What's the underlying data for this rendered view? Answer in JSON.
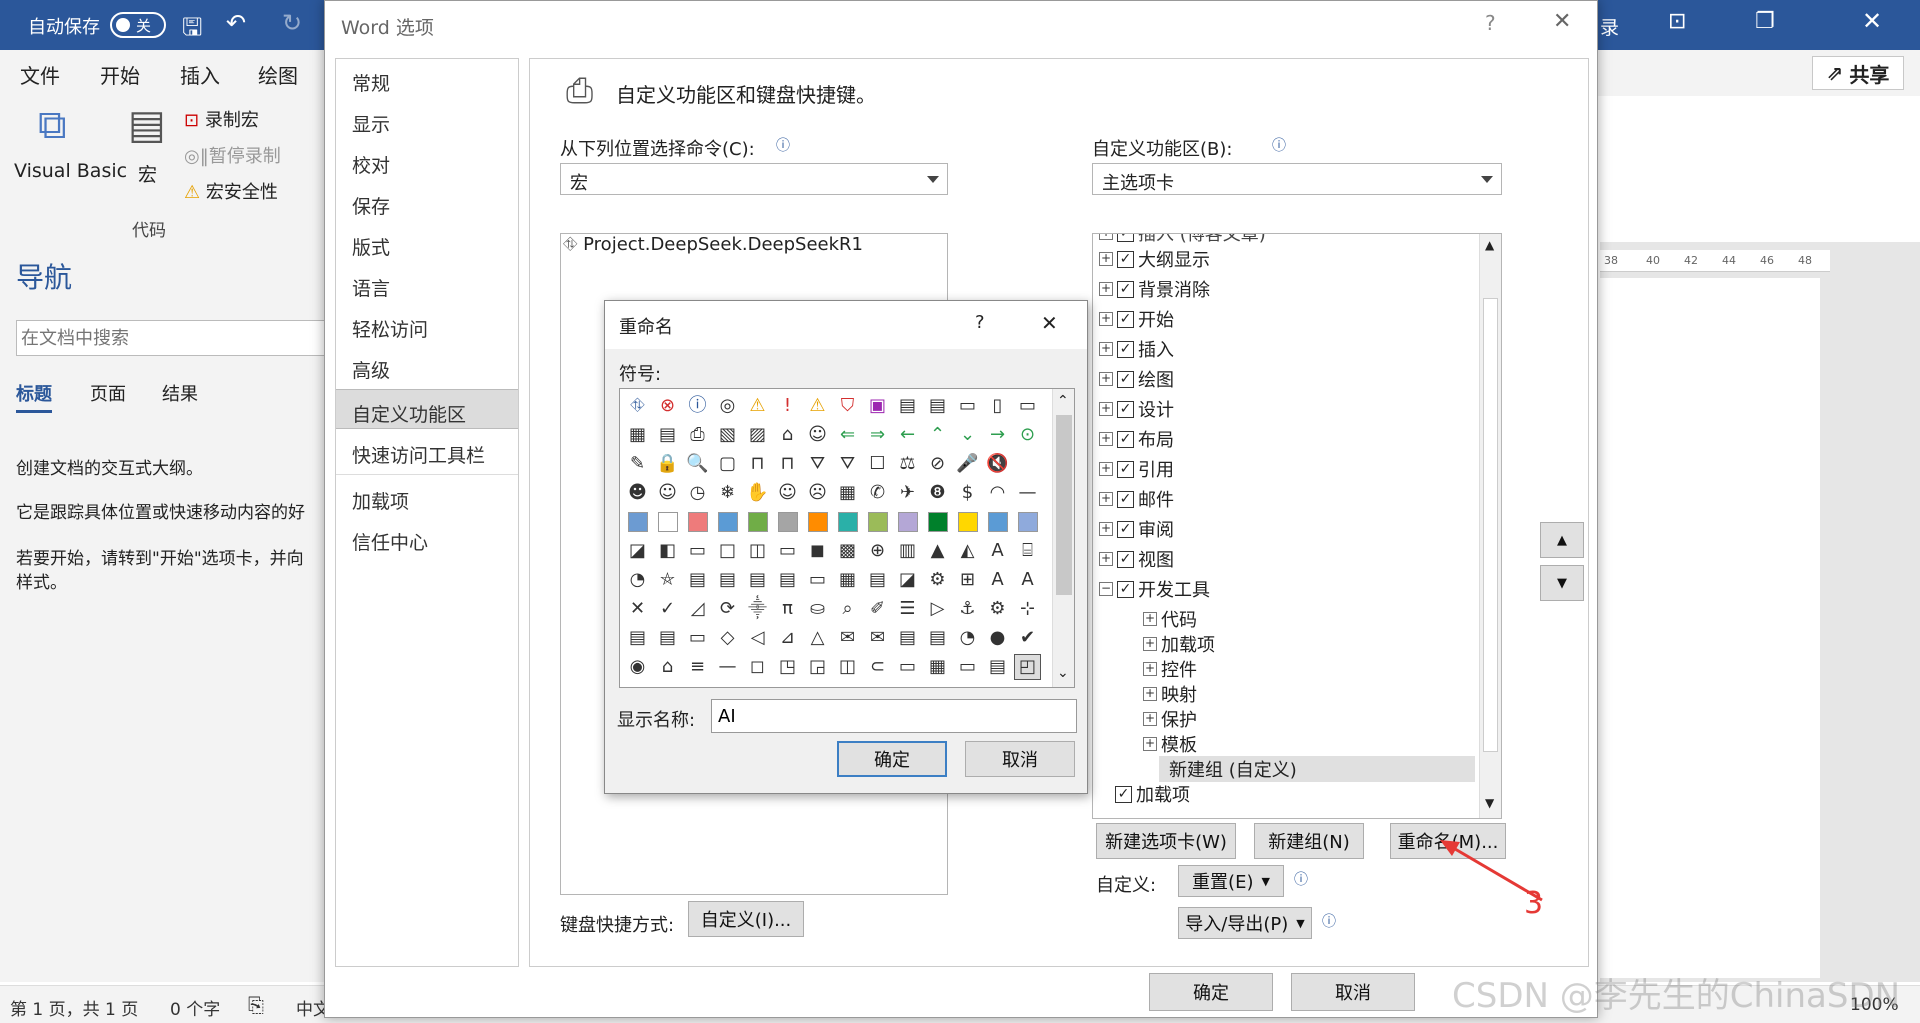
{
  "word": {
    "autosave_label": "自动保存",
    "autosave_state": "关",
    "titlebar_partial": "录",
    "tabs": [
      "文件",
      "开始",
      "插入",
      "绘图"
    ],
    "share_label": "共享",
    "ribbon": {
      "vb_label": "Visual Basic",
      "macro_label": "宏",
      "record_macro": "录制宏",
      "pause_record": "暂停录制",
      "macro_security": "宏安全性",
      "group_label": "代码"
    },
    "nav": {
      "title": "导航",
      "search_placeholder": "在文档中搜索",
      "tabs": [
        "标题",
        "页面",
        "结果"
      ],
      "text1": "创建文档的交互式大纲。",
      "text2": "它是跟踪具体位置或快速移动内容的好",
      "text3": "若要开始，请转到\"开始\"选项卡，并向",
      "text4": "样式。"
    },
    "ruler_marks": [
      "38",
      "40",
      "42",
      "44",
      "46",
      "48"
    ],
    "status": {
      "page": "第 1 页，共 1 页",
      "words": "0 个字",
      "lang": "中文",
      "zoom": "100%"
    }
  },
  "options": {
    "title": "Word 选项",
    "help": "?",
    "close": "✕",
    "left_items": [
      "常规",
      "显示",
      "校对",
      "保存",
      "版式",
      "语言",
      "轻松访问",
      "高级",
      "自定义功能区",
      "快速访问工具栏",
      "加载项",
      "信任中心"
    ],
    "header": "自定义功能区和键盘快捷键。",
    "from_label": "从下列位置选择命令(C):",
    "from_value": "宏",
    "customize_label": "自定义功能区(B):",
    "customize_value": "主选项卡",
    "command_item": "Project.DeepSeek.DeepSeekR1",
    "tree_top_partial": "插入 (博客文章)",
    "tree": [
      {
        "label": "大纲显示",
        "level": 0
      },
      {
        "label": "背景消除",
        "level": 0
      },
      {
        "label": "开始",
        "level": 0
      },
      {
        "label": "插入",
        "level": 0
      },
      {
        "label": "绘图",
        "level": 0
      },
      {
        "label": "设计",
        "level": 0
      },
      {
        "label": "布局",
        "level": 0
      },
      {
        "label": "引用",
        "level": 0
      },
      {
        "label": "邮件",
        "level": 0
      },
      {
        "label": "审阅",
        "level": 0
      },
      {
        "label": "视图",
        "level": 0
      },
      {
        "label": "开发工具",
        "level": 0
      },
      {
        "label": "代码",
        "level": 1
      },
      {
        "label": "加载项",
        "level": 1
      },
      {
        "label": "控件",
        "level": 1
      },
      {
        "label": "映射",
        "level": 1
      },
      {
        "label": "保护",
        "level": 1
      },
      {
        "label": "模板",
        "level": 1
      },
      {
        "label": "新建组 (自定义)",
        "level": 2
      },
      {
        "label": "加载项",
        "level": 3
      }
    ],
    "new_tab_btn": "新建选项卡(W)",
    "new_group_btn": "新建组(N)",
    "rename_btn": "重命名(M)...",
    "customizations_label": "自定义:",
    "reset_btn": "重置(E)",
    "import_export_btn": "导入/导出(P)",
    "keyboard_label": "键盘快捷方式:",
    "keyboard_btn": "自定义(I)...",
    "ok_btn": "确定",
    "cancel_btn": "取消"
  },
  "rename": {
    "title": "重命名",
    "help": "?",
    "close": "✕",
    "symbol_label": "符号:",
    "display_name_label": "显示名称:",
    "display_name_value": "AI",
    "ok_btn": "确定",
    "cancel_btn": "取消",
    "symbol_rows": [
      [
        "⛗",
        "⊗",
        "ⓘ",
        "◎",
        "⚠",
        "!",
        "⚠",
        "⛉",
        "▣",
        "▤",
        "▤",
        "▭",
        "▯",
        "▭"
      ],
      [
        "▦",
        "▤",
        "⎙",
        "▧",
        "▨",
        "⌂",
        "☺",
        "⇐",
        "⇒",
        "←",
        "⌃",
        "⌄",
        "→",
        "⊙"
      ],
      [
        "✎",
        "🔒",
        "🔍",
        "▢",
        "⊓",
        "⊓",
        "⛛",
        "⛛",
        "☐",
        "⚖",
        "⊘",
        "🎤",
        "🔇",
        ""
      ],
      [
        "☻",
        "☺",
        "◷",
        "❄",
        "✋",
        "☺",
        "☹",
        "▦",
        "✆",
        "✈",
        "❽",
        "$",
        "◠",
        "—"
      ],
      [
        "▦",
        "□",
        "■",
        "■",
        "■",
        "■",
        "■",
        "■",
        "■",
        "■",
        "■",
        "■",
        "■",
        "■"
      ],
      [
        "◪",
        "◧",
        "▭",
        "□",
        "◫",
        "▭",
        "◼",
        "▩",
        "⊕",
        "▥",
        "▲",
        "◭",
        "A",
        "⌸"
      ],
      [
        "◔",
        "⛤",
        "▤",
        "▤",
        "▤",
        "▤",
        "▭",
        "▦",
        "▤",
        "◪",
        "⚙",
        "⊞",
        "A",
        "A"
      ],
      [
        "✕",
        "✓",
        "◿",
        "⟳",
        "⸎",
        "π",
        "⛀",
        "⌕",
        "✐",
        "☰",
        "▷",
        "⚓",
        "⚙",
        "⊹"
      ],
      [
        "▤",
        "▤",
        "▭",
        "◇",
        "◁",
        "⊿",
        "△",
        "✉",
        "✉",
        "▤",
        "▤",
        "◔",
        "●",
        "✔"
      ],
      [
        "◉",
        "⌂",
        "≡",
        "—",
        "◻",
        "◳",
        "◲",
        "◫",
        "⊂",
        "▭",
        "▦",
        "▭",
        "▤",
        "◰"
      ]
    ]
  },
  "annotation": "3",
  "watermark": "CSDN @李先生的ChinaSDN",
  "colors": {
    "word_blue": "#2b579a",
    "annot_red": "#e53935"
  }
}
